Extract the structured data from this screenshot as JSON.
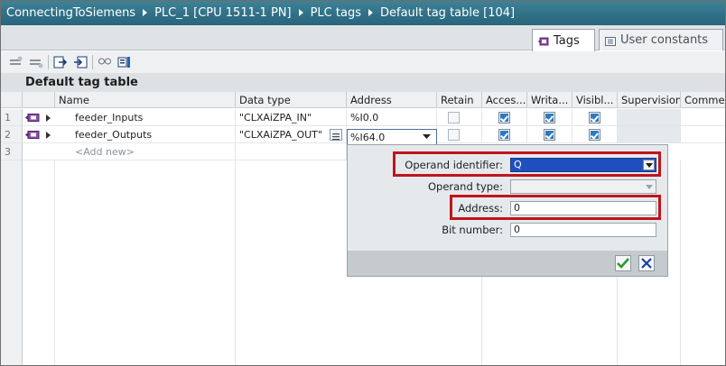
{
  "breadcrumb": [
    "ConnectingToSiemens",
    "PLC_1 [CPU 1511-1 PN]",
    "PLC tags",
    "Default tag table [104]"
  ],
  "tabs": [
    {
      "label": "Tags",
      "active": true
    },
    {
      "label": "User constants",
      "active": false
    }
  ],
  "table_title": "Default tag table",
  "columns": [
    "Name",
    "Data type",
    "Address",
    "Retain",
    "Acces...",
    "Writa...",
    "Visibl...",
    "Supervision",
    "Commen"
  ],
  "rows": [
    {
      "num": "1",
      "name": "feeder_Inputs",
      "datatype": "\"CLXAiZPA_IN\"",
      "address": "%I0.0",
      "retain": false,
      "accessible": true,
      "writable": true,
      "visible": true
    },
    {
      "num": "2",
      "name": "feeder_Outputs",
      "datatype": "\"CLXAiZPA_OUT\"",
      "address": "%I64.0",
      "retain": false,
      "accessible": true,
      "writable": true,
      "visible": true
    },
    {
      "num": "3",
      "name": "<Add new>"
    }
  ],
  "popup": {
    "operand_identifier_label": "Operand identifier:",
    "operand_identifier_value": "Q",
    "operand_type_label": "Operand type:",
    "operand_type_value": "",
    "address_label": "Address:",
    "address_value": "0",
    "bit_number_label": "Bit number:",
    "bit_number_value": "0"
  },
  "colors": {
    "titlebar": "#2f6f86",
    "highlight_box": "#c0141b",
    "selection": "#1f4fbf"
  },
  "icons": [
    "tag-structure-icon",
    "expand-arrow-icon",
    "check-icon",
    "cancel-icon",
    "dropdown-arrow-icon",
    "browse-icon"
  ]
}
